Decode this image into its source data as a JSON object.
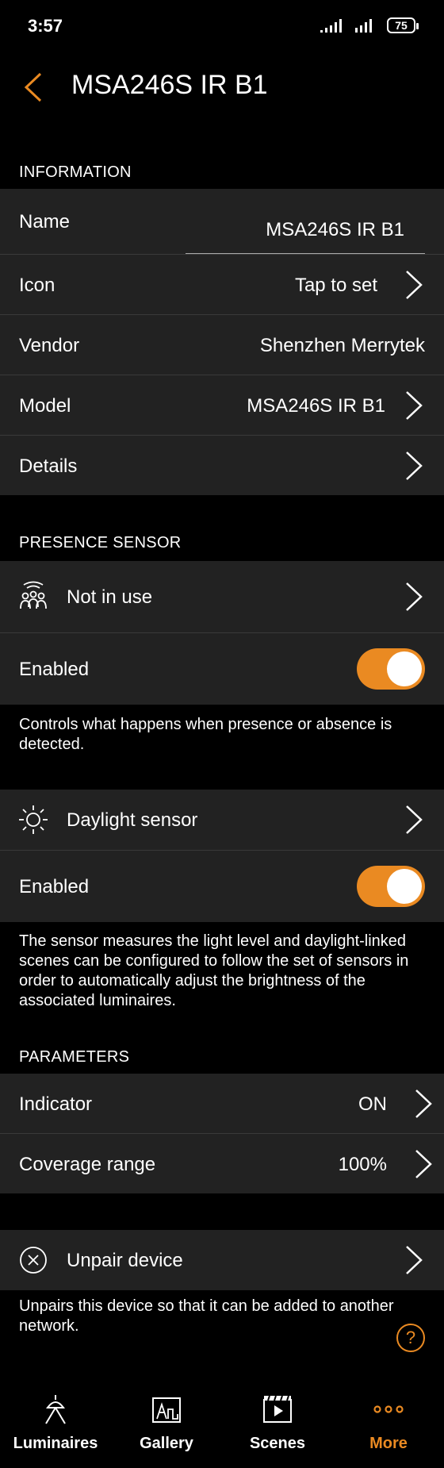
{
  "status_bar": {
    "time": "3:57",
    "battery": "75"
  },
  "header": {
    "title": "MSA246S IR B1"
  },
  "information": {
    "section_label": "INFORMATION",
    "name_label": "Name",
    "name_value": "MSA246S IR B1",
    "icon_label": "Icon",
    "icon_value": "Tap to set",
    "vendor_label": "Vendor",
    "vendor_value": "Shenzhen Merrytek",
    "model_label": "Model",
    "model_value": "MSA246S IR B1",
    "details_label": "Details"
  },
  "presence_sensor": {
    "section_label": "PRESENCE SENSOR",
    "status_label": "Not in use",
    "enabled_label": "Enabled",
    "enabled": true,
    "description": "Controls what happens when presence or absence is detected."
  },
  "daylight_sensor": {
    "label": "Daylight sensor",
    "enabled_label": "Enabled",
    "enabled": true,
    "description": "The sensor measures the light level and daylight-linked scenes can be configured to follow the set of sensors in order to automatically adjust the brightness of the associated luminaires."
  },
  "parameters": {
    "section_label": "PARAMETERS",
    "indicator_label": "Indicator",
    "indicator_value": "ON",
    "coverage_label": "Coverage range",
    "coverage_value": "100%"
  },
  "unpair": {
    "label": "Unpair device",
    "description": "Unpairs this device so that it can be added to another network."
  },
  "help": {
    "glyph": "?"
  },
  "bottom_nav": {
    "items": [
      {
        "label": "Luminaires",
        "icon": "luminaire-icon"
      },
      {
        "label": "Gallery",
        "icon": "gallery-icon"
      },
      {
        "label": "Scenes",
        "icon": "scenes-icon"
      },
      {
        "label": "More",
        "icon": "more-icon",
        "active": true
      }
    ]
  },
  "colors": {
    "accent": "#ea8a22",
    "row_bg": "#222222",
    "background": "#000000"
  }
}
